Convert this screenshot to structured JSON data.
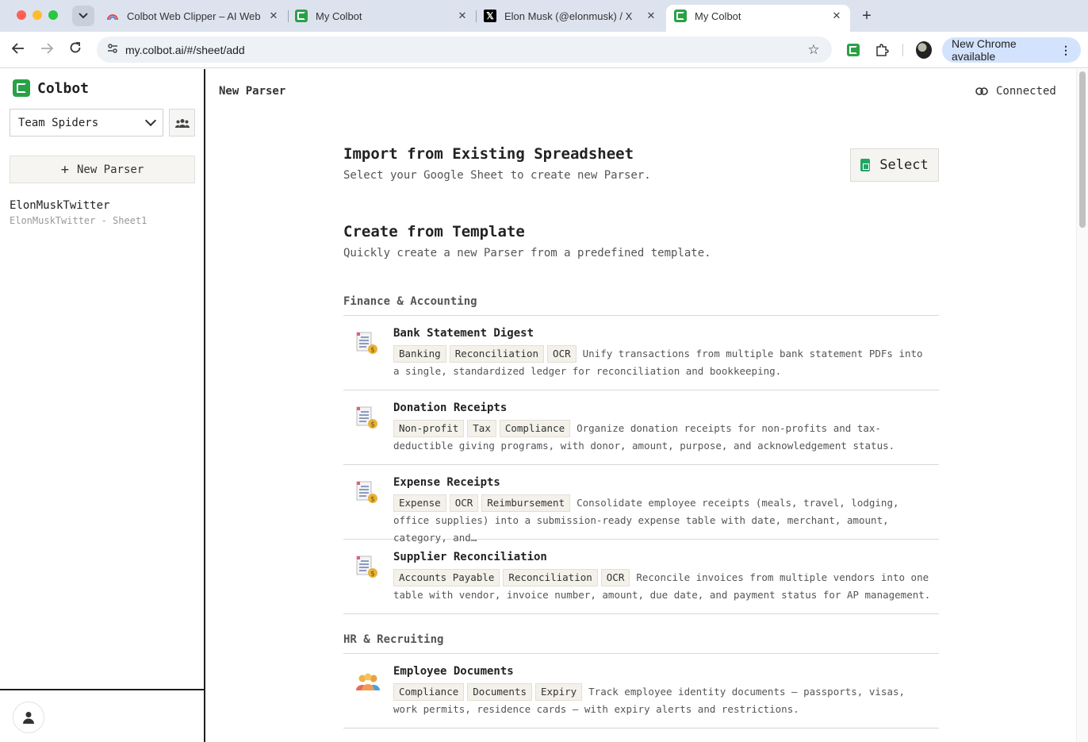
{
  "browser": {
    "tabs": [
      {
        "title": "Colbot Web Clipper – AI Web",
        "favicon": "rainbow-icon",
        "active": false
      },
      {
        "title": "My Colbot",
        "favicon": "colbot-icon",
        "active": false
      },
      {
        "title": "Elon Musk (@elonmusk) / X",
        "favicon": "x-icon",
        "active": false
      },
      {
        "title": "My Colbot",
        "favicon": "colbot-icon",
        "active": true
      }
    ],
    "close_glyph": "✕",
    "new_tab_glyph": "+",
    "url": "my.colbot.ai/#/sheet/add",
    "update_label": "New Chrome available"
  },
  "sidebar": {
    "brand": "Colbot",
    "team": "Team Spiders",
    "new_parser_label": "New Parser",
    "parsers": [
      {
        "title": "ElonMuskTwitter",
        "subtitle": "ElonMuskTwitter - Sheet1"
      }
    ]
  },
  "main": {
    "page_title": "New Parser",
    "connection_status": "Connected",
    "import": {
      "title": "Import from Existing Spreadsheet",
      "subtitle": "Select your Google Sheet to create new Parser.",
      "button_label": "Select"
    },
    "template": {
      "title": "Create from Template",
      "subtitle": "Quickly create a new Parser from a predefined template."
    },
    "categories": [
      {
        "name": "Finance & Accounting",
        "items": [
          {
            "title": "Bank Statement Digest",
            "tags": [
              "Banking",
              "Reconciliation",
              "OCR"
            ],
            "description": "Unify transactions from multiple bank statement PDFs into a single, standardized ledger for reconciliation and bookkeeping."
          },
          {
            "title": "Donation Receipts",
            "tags": [
              "Non-profit",
              "Tax",
              "Compliance"
            ],
            "description": "Organize donation receipts for non-profits and tax-deductible giving programs, with donor, amount, purpose, and acknowledgement status."
          },
          {
            "title": "Expense Receipts",
            "tags": [
              "Expense",
              "OCR",
              "Reimbursement"
            ],
            "description": "Consolidate employee receipts (meals, travel, lodging, office supplies) into a submission-ready expense table with date, merchant, amount, category, and…"
          },
          {
            "title": "Supplier Reconciliation",
            "tags": [
              "Accounts Payable",
              "Reconciliation",
              "OCR"
            ],
            "description": "Reconcile invoices from multiple vendors into one table with vendor, invoice number, amount, due date, and payment status for AP management."
          }
        ]
      },
      {
        "name": "HR & Recruiting",
        "items": [
          {
            "title": "Employee Documents",
            "tags": [
              "Compliance",
              "Documents",
              "Expiry"
            ],
            "description": "Track employee identity documents — passports, visas, work permits, residence cards — with expiry alerts and restrictions."
          }
        ]
      }
    ]
  }
}
